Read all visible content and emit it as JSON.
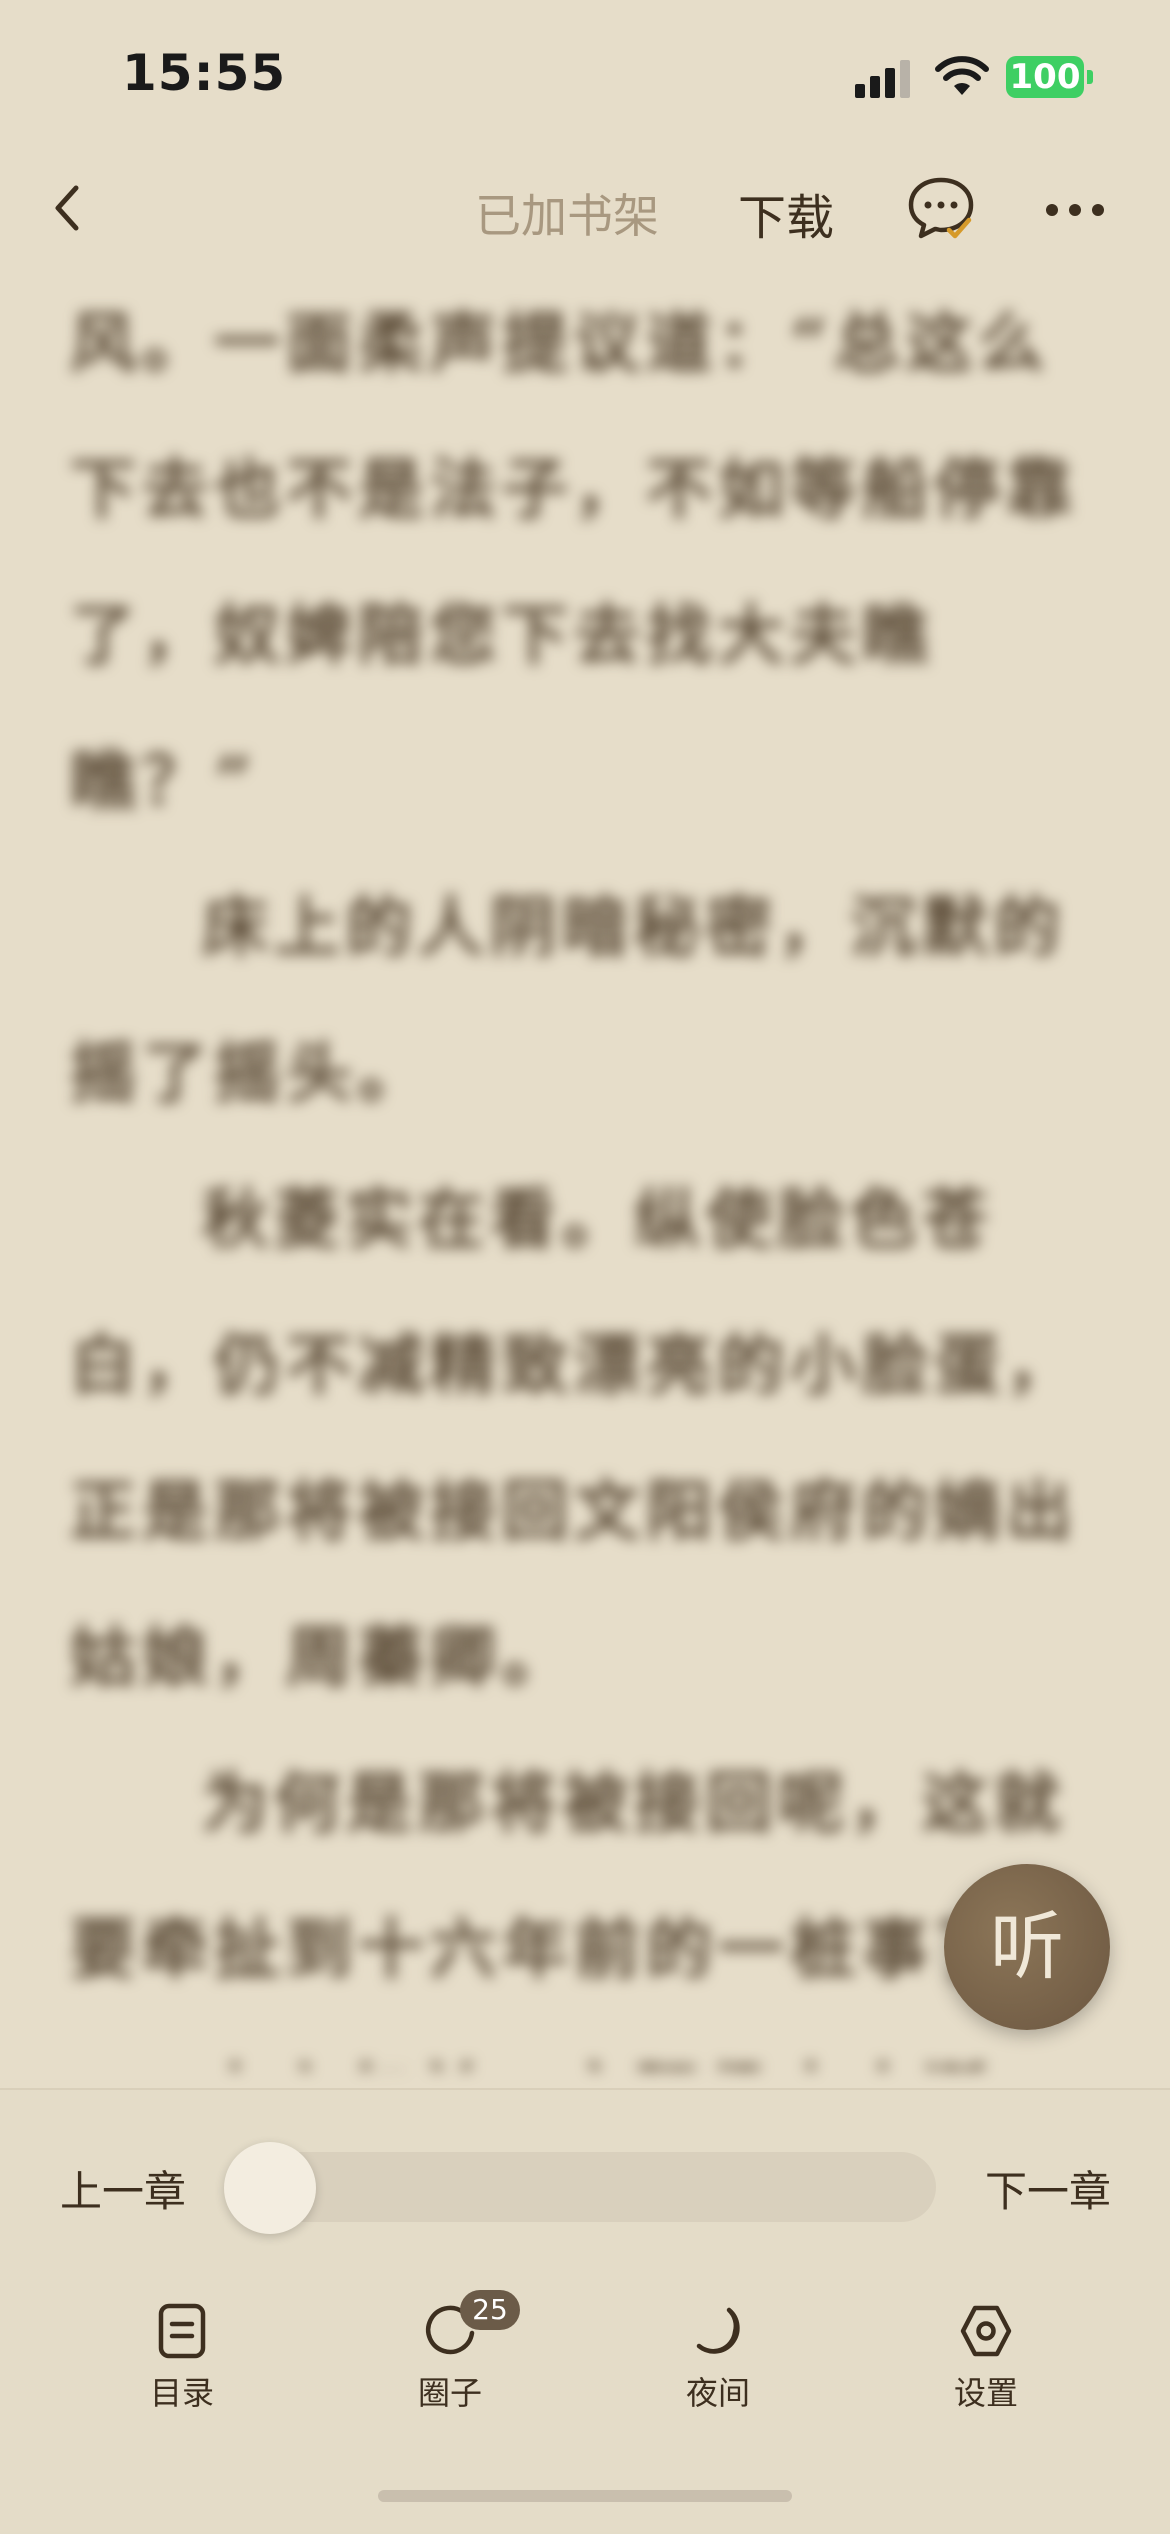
{
  "status_bar": {
    "time": "15:55",
    "battery": "100"
  },
  "top_nav": {
    "added_to_shelf": "已加书架",
    "download": "下载"
  },
  "content": {
    "paragraphs": [
      {
        "text": "风。一面柔声提议道：“总这么下去也不是法子，不如等船停靠了，奴婢陪您下去找大夫瞧瞧？”",
        "indent": false
      },
      {
        "text": "床上的人阴暗秘密，沉默的摇了摇头。",
        "indent": true
      },
      {
        "text": "秋菱实在看。纵使脸色苍白，仍不减精致漂亮的小脸蛋，正是那将被接回文阳侯府的嫡出姑娘，周蓁卿。",
        "indent": true
      },
      {
        "text": "为何是那将被接回呢，这就要牵扯到十六年前的一桩事了。",
        "indent": true
      },
      {
        "text": "十六年前，文阳侯夫人诞下……",
        "indent": true
      }
    ]
  },
  "listen_button": {
    "label": "听"
  },
  "chapter_nav": {
    "prev": "上一章",
    "next": "下一章",
    "progress": 0.0
  },
  "toolbar": {
    "items": [
      {
        "label": "目录",
        "icon": "catalog-icon"
      },
      {
        "label": "圈子",
        "icon": "circle-icon",
        "badge": "25"
      },
      {
        "label": "夜间",
        "icon": "moon-icon"
      },
      {
        "label": "设置",
        "icon": "settings-icon"
      }
    ]
  }
}
